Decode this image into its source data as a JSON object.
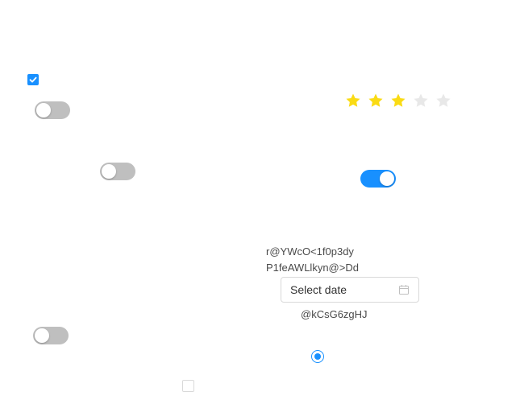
{
  "checkbox_top": {
    "checked": true
  },
  "switch_1": {
    "on": false
  },
  "switch_2": {
    "on": false
  },
  "switch_3": {
    "on": true
  },
  "switch_4": {
    "on": false
  },
  "rating": {
    "value": 3,
    "max": 5,
    "filled_color": "#fadb14",
    "empty_color": "#e8e8e8"
  },
  "text_block": {
    "line1": "r@YWcO<1f0p3dy",
    "line2": "P1feAWLlkyn@>Dd"
  },
  "date_picker": {
    "placeholder": "Select date",
    "icon": "calendar-icon"
  },
  "plain_text": "@kCsG6zgHJ",
  "radio": {
    "checked": true
  },
  "checkbox_bottom": {
    "checked": false
  },
  "colors": {
    "accent": "#1890ff",
    "switch_off": "#bfbfbf"
  }
}
